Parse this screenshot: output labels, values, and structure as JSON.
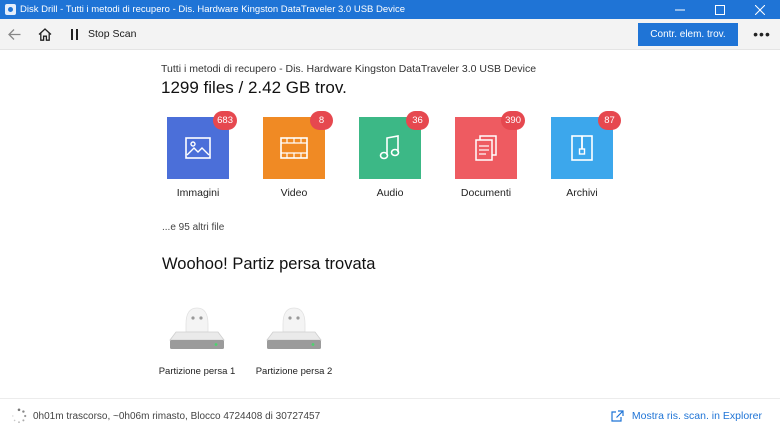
{
  "window": {
    "title": "Disk Drill - Tutti i metodi di recupero - Dis. Hardware Kingston DataTraveler 3.0 USB Device",
    "controls": [
      "minimize-icon",
      "maximize-icon",
      "close-icon"
    ]
  },
  "toolbar": {
    "stop_label": "Stop Scan",
    "primary_label": "Contr. elem. trov.",
    "more_label": "•••"
  },
  "scan": {
    "subtitle": "Tutti i metodi di recupero - Dis. Hardware Kingston DataTraveler 3.0 USB Device",
    "summary": "1299 files / 2.42 GB trov."
  },
  "categories": [
    {
      "label": "Immagini",
      "count": "683",
      "color": "#4b6fd9",
      "icon": "image-icon"
    },
    {
      "label": "Video",
      "count": "8",
      "color": "#f08a24",
      "icon": "film-icon"
    },
    {
      "label": "Audio",
      "count": "36",
      "color": "#3cb886",
      "icon": "music-note-icon"
    },
    {
      "label": "Documenti",
      "count": "390",
      "color": "#ee5b61",
      "icon": "documents-icon"
    },
    {
      "label": "Archivi",
      "count": "87",
      "color": "#3ca7ec",
      "icon": "archive-icon"
    }
  ],
  "more_files": "...e 95 altri file",
  "lost_partitions": {
    "title": "Woohoo! Partiz persa trovata",
    "items": [
      {
        "label": "Partizione persa 1"
      },
      {
        "label": "Partizione persa 2"
      }
    ]
  },
  "status": {
    "text": "0h01m trascorso, ~0h06m rimasto, Blocco 4724408 di 30727457",
    "explorer_link": "Mostra ris. scan. in Explorer"
  },
  "colors": {
    "accent": "#1f74d6",
    "badge": "#e6484f"
  }
}
